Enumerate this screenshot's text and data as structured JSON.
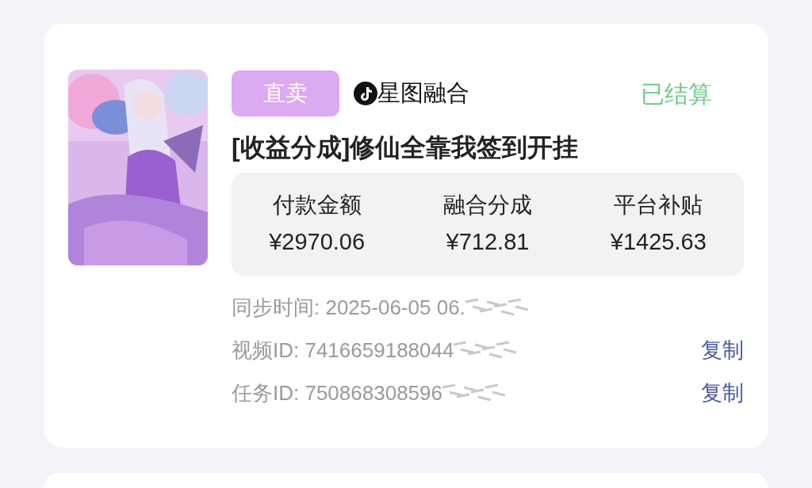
{
  "order": {
    "channel_tag": "直卖",
    "platform": "星图融合",
    "status": "已结算",
    "title": "[收益分成]修仙全靠我签到开挂",
    "stats": [
      {
        "label": "付款金额",
        "value": "¥2970.06"
      },
      {
        "label": "融合分成",
        "value": "¥712.81"
      },
      {
        "label": "平台补贴",
        "value": "¥1425.63"
      }
    ],
    "details": [
      {
        "text": "同步时间: 2025-06-05 06.",
        "redacted": true
      },
      {
        "text": "视频ID: 7416659188044",
        "redacted": true,
        "action": "复制"
      },
      {
        "text": "任务ID: 750868308596",
        "redacted": true,
        "action": "复制"
      }
    ]
  }
}
